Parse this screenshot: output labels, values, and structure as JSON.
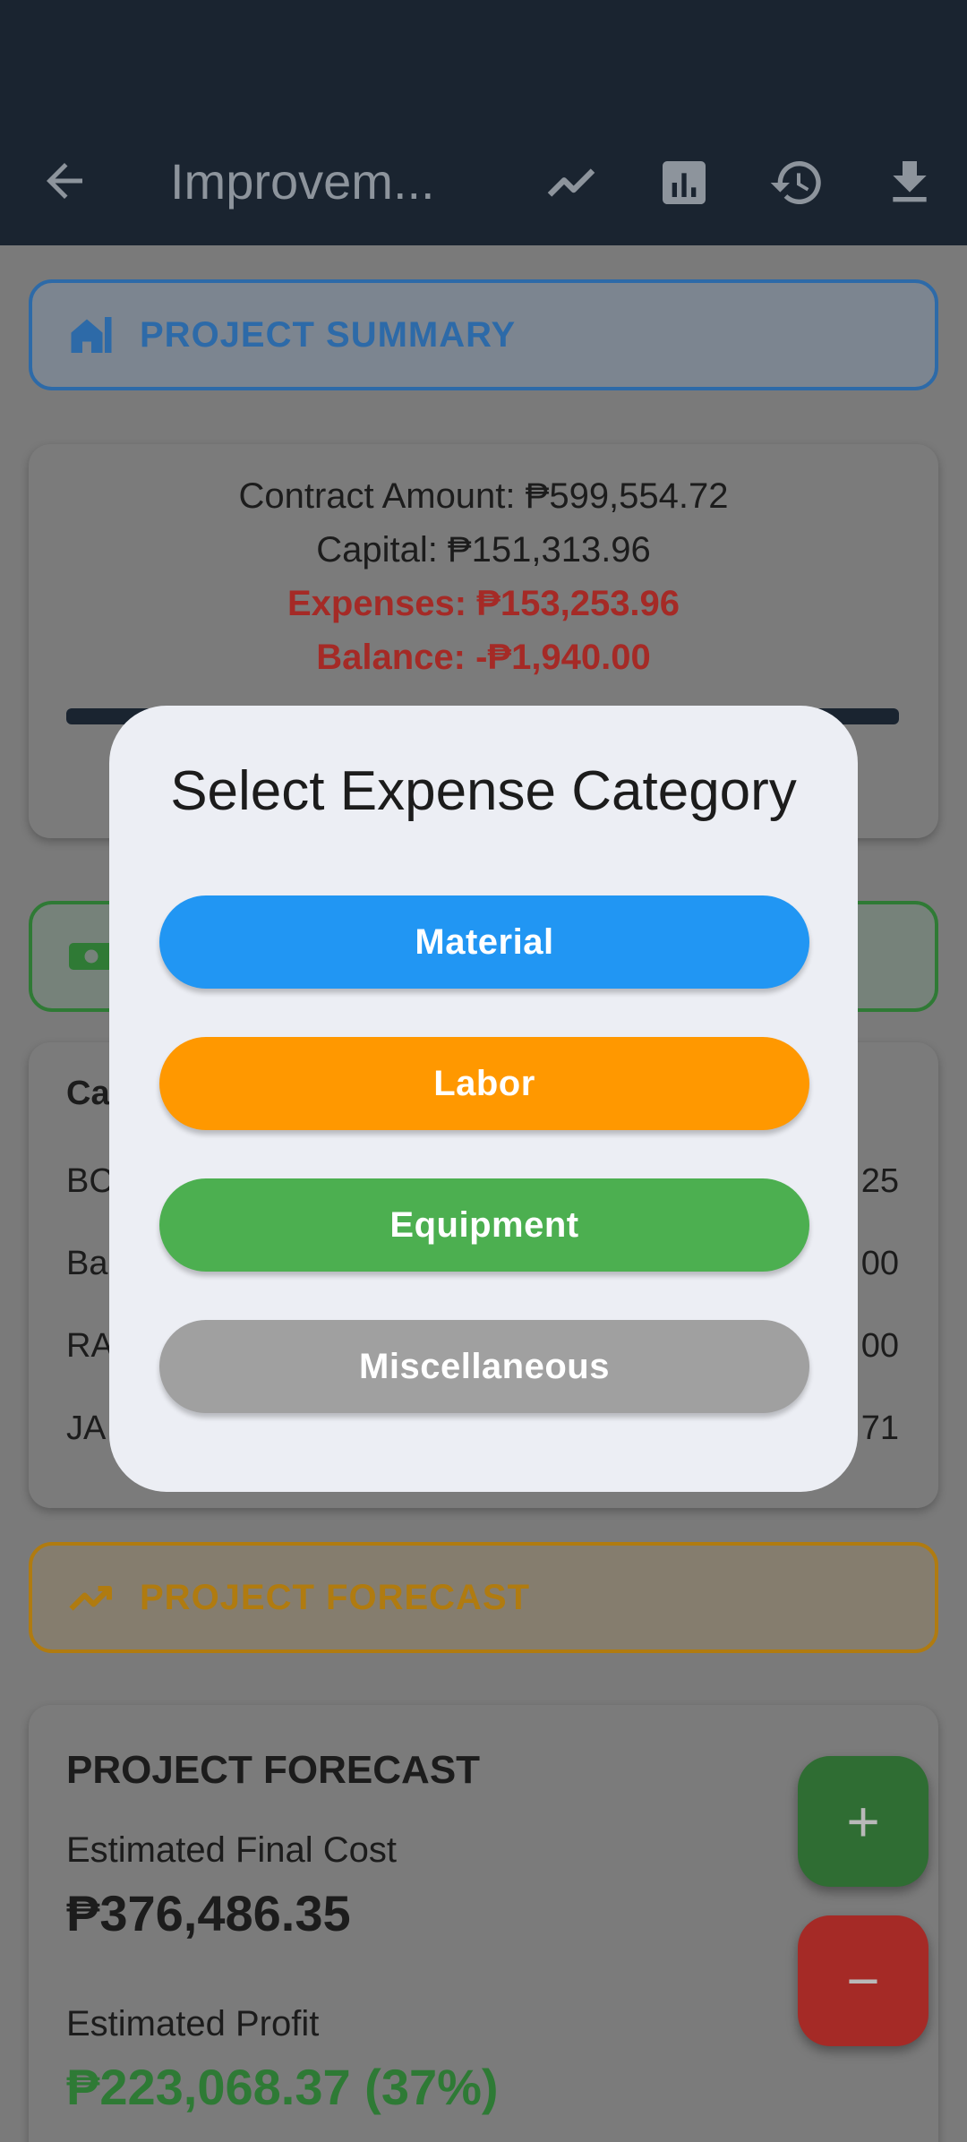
{
  "appbar": {
    "title": "Improvem...",
    "icons": [
      "back-arrow-icon",
      "trend-line-icon",
      "bar-chart-icon",
      "history-icon",
      "download-icon"
    ]
  },
  "summary": {
    "header": "PROJECT SUMMARY",
    "contract": "Contract Amount: ₱599,554.72",
    "capital": "Capital: ₱151,313.96",
    "expenses": "Expenses: ₱153,253.96",
    "balance": "Balance: -₱1,940.00",
    "progress_fraction": 1.0
  },
  "expenses": {
    "header_partial": "Ca",
    "rows": [
      {
        "left": "BC",
        "right": "25"
      },
      {
        "left": "Ba",
        "right": "00"
      },
      {
        "left": "RA",
        "right": "00"
      },
      {
        "left": "JA",
        "right": "71"
      }
    ]
  },
  "forecast": {
    "header": "PROJECT FORECAST",
    "card_title": "PROJECT FORECAST",
    "final_cost_label": "Estimated Final Cost",
    "final_cost_value": "₱376,486.35",
    "profit_label": "Estimated Profit",
    "profit_value": "₱223,068.37 (37%)"
  },
  "fabs": {
    "add": "+",
    "subtract": "−"
  },
  "dialog": {
    "title": "Select Expense Category",
    "options": [
      {
        "label": "Material",
        "color": "#2196f3"
      },
      {
        "label": "Labor",
        "color": "#ff9800"
      },
      {
        "label": "Equipment",
        "color": "#4caf50"
      },
      {
        "label": "Miscellaneous",
        "color": "#a0a0a0"
      }
    ]
  },
  "colors": {
    "appbar": "#1a2430",
    "summary_accent": "#2d6aa8",
    "expenses_accent": "#2f7a35",
    "forecast_accent": "#b07b10",
    "negative": "#a52a26",
    "profit": "#2e7a35",
    "fab_add": "#2f6d33",
    "fab_subtract": "#a52a26"
  }
}
